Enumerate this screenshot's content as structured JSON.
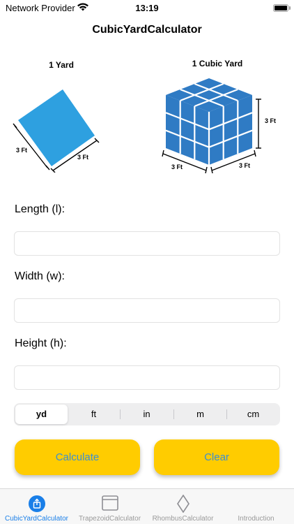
{
  "status_bar": {
    "carrier": "Network Provider",
    "time": "13:19"
  },
  "nav": {
    "title": "CubicYardCalculator"
  },
  "illustrations": {
    "square_title": "1 Yard",
    "square_side_left": "3 Ft",
    "square_side_right": "3 Ft",
    "cube_title": "1 Cubic Yard",
    "cube_height": "3 Ft",
    "cube_side_left": "3 Ft",
    "cube_side_right": "3 Ft",
    "fill_color": "#2f7bc4",
    "square_color": "#2ea0e0"
  },
  "form": {
    "length_label": "Length (l):",
    "length_value": "",
    "width_label": "Width (w):",
    "width_value": "",
    "height_label": "Height (h):",
    "height_value": ""
  },
  "units": {
    "options": [
      "yd",
      "ft",
      "in",
      "m",
      "cm"
    ],
    "selected": "yd"
  },
  "buttons": {
    "calculate": "Calculate",
    "clear": "Clear",
    "color": "#ffcc00",
    "text_color": "#3a8fd4"
  },
  "tabs": [
    {
      "label": "CubicYardCalculator",
      "icon": "share-square-icon",
      "active": true
    },
    {
      "label": "TrapezoidCalculator",
      "icon": "window-icon",
      "active": false
    },
    {
      "label": "RhombusCalculator",
      "icon": "rhombus-icon",
      "active": false
    },
    {
      "label": "Introduction",
      "icon": "",
      "active": false
    }
  ]
}
